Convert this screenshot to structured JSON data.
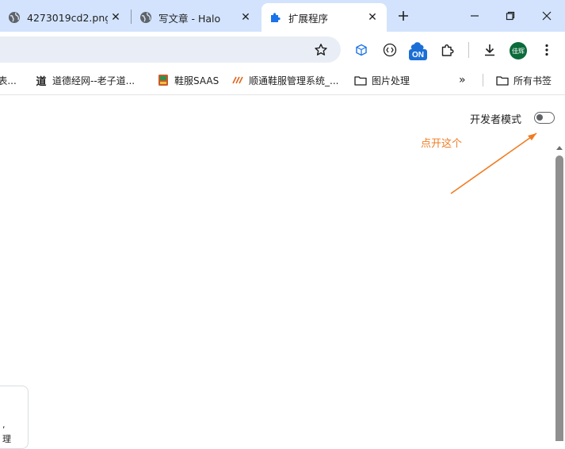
{
  "tabs": [
    {
      "title": "4273019cd2.png",
      "active": false,
      "favicon": "globe-icon"
    },
    {
      "title": "写文章 - Halo",
      "active": false,
      "favicon": "globe-icon"
    },
    {
      "title": "扩展程序",
      "active": true,
      "favicon": "puzzle-icon"
    }
  ],
  "toolbar": {
    "extension_badge": "ON",
    "avatar_text": "佳辉"
  },
  "bookmarks": [
    {
      "label": "l表...",
      "icon": "bookmark-icon"
    },
    {
      "label": "道德经网--老子道...",
      "icon": "dao-icon"
    },
    {
      "label": "鞋服SAAS",
      "icon": "app-icon"
    },
    {
      "label": "顺通鞋服管理系统_...",
      "icon": "app-icon"
    },
    {
      "label": "图片处理",
      "icon": "folder-icon"
    },
    {
      "label": "所有书签",
      "icon": "folder-icon"
    }
  ],
  "page": {
    "developer_mode_label": "开发者模式",
    "developer_mode_enabled": false,
    "annotation_text": "点开这个",
    "bottom_fragments": [
      ",",
      "理"
    ]
  },
  "colors": {
    "tabstrip_bg": "#d3e3fd",
    "omnibox_bg": "#e9eef6",
    "annotation": "#f07b22",
    "badge_blue": "#1a6fd6",
    "avatar_green": "#0b6b3a"
  }
}
